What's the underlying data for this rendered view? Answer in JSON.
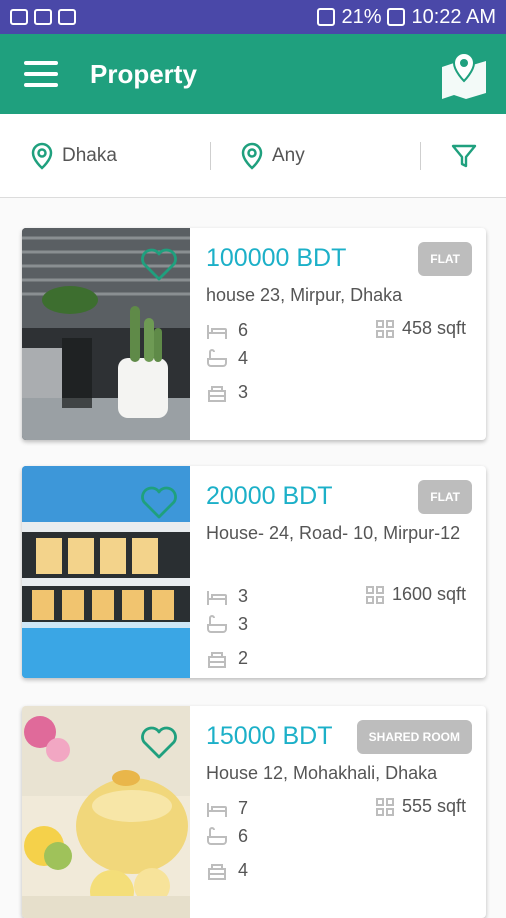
{
  "status_bar": {
    "battery": "21%",
    "time": "10:22 AM"
  },
  "app_bar": {
    "title": "Property"
  },
  "filters": {
    "location": "Dhaka",
    "type": "Any"
  },
  "listings": [
    {
      "price": "100000 BDT",
      "address": "house 23, Mirpur, Dhaka",
      "badge": "FLAT",
      "beds": "6",
      "baths": "4",
      "kitchens": "3",
      "area": "458 sqft"
    },
    {
      "price": "20000 BDT",
      "address": "House- 24, Road- 10, Mirpur-12",
      "badge": "FLAT",
      "beds": "3",
      "baths": "3",
      "kitchens": "2",
      "area": "1600 sqft"
    },
    {
      "price": "15000 BDT",
      "address": "House 12, Mohakhali, Dhaka",
      "badge": "SHARED ROOM",
      "beds": "7",
      "baths": "6",
      "kitchens": "4",
      "area": "555 sqft"
    }
  ],
  "colors": {
    "status_bar": "#4a48a8",
    "app_bar": "#1fa07e",
    "price": "#1cb0c8",
    "badge": "#bdbdbd"
  }
}
